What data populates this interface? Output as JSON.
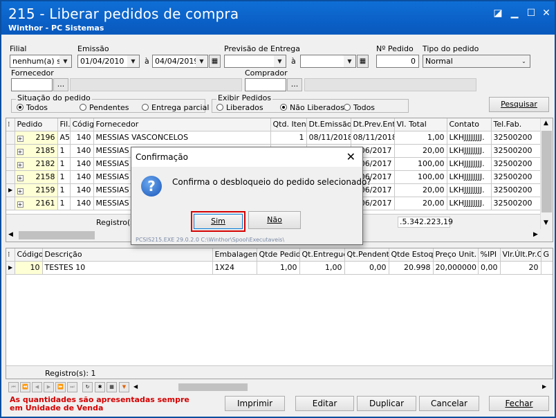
{
  "window": {
    "title": "215 - Liberar pedidos de compra",
    "subtitle": "Winthor - PC Sistemas"
  },
  "filters": {
    "filial_label": "Filial",
    "filial_value": "nenhum(a) se",
    "emissao_label": "Emissão",
    "emissao_from": "01/04/2010",
    "emissao_sep": "à",
    "emissao_to": "04/04/2019",
    "previsao_label": "Previsão de Entrega",
    "previsao_sep": "à",
    "npedido_label": "Nº Pedido",
    "npedido_value": "0",
    "tipo_label": "Tipo do pedido",
    "tipo_value": "Normal",
    "fornecedor_label": "Fornecedor",
    "comprador_label": "Comprador",
    "ellipsis": "...",
    "situacao_label": "Situação do pedido",
    "situacao_options": [
      "Todos",
      "Pendentes",
      "Entrega parcial"
    ],
    "exibir_label": "Exibir Pedidos",
    "exibir_options": [
      "Liberados",
      "Não Liberados",
      "Todos"
    ],
    "pesquisar": "Pesquisar"
  },
  "grid1": {
    "columns": [
      "Pedido",
      "Fil.",
      "Códig",
      "Fornecedor",
      "Qtd. Itens",
      "Dt.Emissão",
      "Dt.Prev.Ent",
      "Vl. Total",
      "Contato",
      "Tel.Fab."
    ],
    "rows": [
      [
        "2196",
        "A5",
        "140",
        "MESSIAS VASCONCELOS",
        "1",
        "08/11/2018",
        "08/11/2018",
        "1,00",
        "LKHJJJJJJJJ.",
        "32500200"
      ],
      [
        "2185",
        "1",
        "140",
        "MESSIAS V",
        "",
        "",
        "/06/2017",
        "20,00",
        "LKHJJJJJJJJ.",
        "32500200"
      ],
      [
        "2182",
        "1",
        "140",
        "MESSIAS V",
        "",
        "",
        "/06/2017",
        "100,00",
        "LKHJJJJJJJJ.",
        "32500200"
      ],
      [
        "2158",
        "1",
        "140",
        "MESSIAS V",
        "",
        "",
        "/06/2017",
        "100,00",
        "LKHJJJJJJJJ.",
        "32500200"
      ],
      [
        "2159",
        "1",
        "140",
        "MESSIAS V",
        "",
        "",
        "/06/2017",
        "20,00",
        "LKHJJJJJJJJ.",
        "32500200"
      ],
      [
        "2161",
        "1",
        "140",
        "MESSIAS V",
        "",
        "",
        "/06/2017",
        "20,00",
        "LKHJJJJJJJJ.",
        "32500200"
      ]
    ],
    "registros_label": "Registro(s)",
    "total_value": ".5.342.223,19"
  },
  "grid2": {
    "columns": [
      "Código",
      "Descrição",
      "Embalagem",
      "Qtde Pedida",
      "Qt.Entregue",
      "Qt.Pendente",
      "Qtde Estoque",
      "Preço Unit.",
      "%IPI",
      "Vlr.Últ.Pr.Co",
      "G"
    ],
    "rows": [
      [
        "10",
        "TESTES 10",
        "1X24",
        "1,00",
        "1,00",
        "0,00",
        "20.998",
        "20,000000",
        "0,00",
        "20",
        ""
      ]
    ],
    "registros": "Registro(s): 1"
  },
  "dialog": {
    "title": "Confirmação",
    "icon": "question-icon",
    "message": "Confirma o desbloqueio do pedido selecionado?",
    "yes": "Sim",
    "no": "Não",
    "footer": "PCSIS215.EXE 29.0.2.0 C:\\Winthor\\Spool\\Executaveis\\"
  },
  "footer": {
    "warning": "As quantidades são apresentadas sempre em Unidade de Venda",
    "imprimir": "Imprimir",
    "editar": "Editar",
    "duplicar": "Duplicar",
    "cancelar": "Cancelar",
    "fechar": "Fechar"
  },
  "colors": {
    "titlebar": "#0a5ec4",
    "selection": "#ffffd5",
    "highlight_border": "#d40000",
    "warning_text": "#d40000"
  }
}
